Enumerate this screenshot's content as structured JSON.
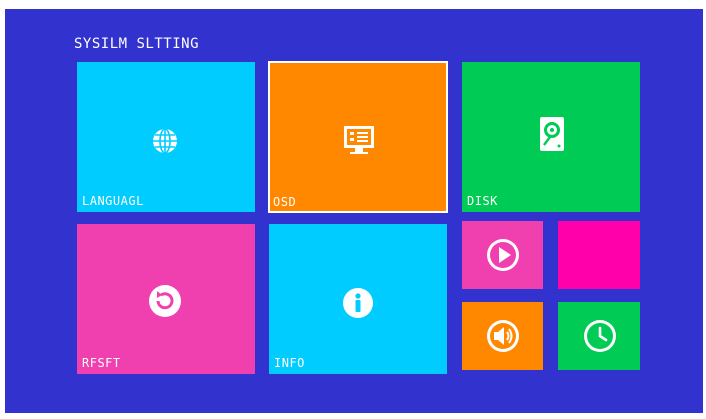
{
  "screen": {
    "title": "SYSILM SLTTING",
    "background": "#3232cf"
  },
  "tiles": [
    {
      "id": "language",
      "label": "LANGUAGL",
      "color": "#00ccff",
      "icon": "globe-icon"
    },
    {
      "id": "osd",
      "label": "OSD",
      "color": "#ff8800",
      "icon": "monitor-icon",
      "selected": true
    },
    {
      "id": "disk",
      "label": "DISK",
      "color": "#00cc55",
      "icon": "hard-drive-icon"
    },
    {
      "id": "reset",
      "label": "RFSFT",
      "color": "#f040b0",
      "icon": "reset-icon"
    },
    {
      "id": "info",
      "label": "INFO",
      "color": "#00ccff",
      "icon": "info-icon"
    },
    {
      "id": "playback",
      "label": "",
      "color": "#f040b0",
      "icon": "play-icon"
    },
    {
      "id": "blank",
      "label": "",
      "color": "#ff00aa",
      "icon": ""
    },
    {
      "id": "volume",
      "label": "",
      "color": "#ff8800",
      "icon": "volume-icon"
    },
    {
      "id": "time",
      "label": "",
      "color": "#00cc55",
      "icon": "clock-icon"
    }
  ]
}
